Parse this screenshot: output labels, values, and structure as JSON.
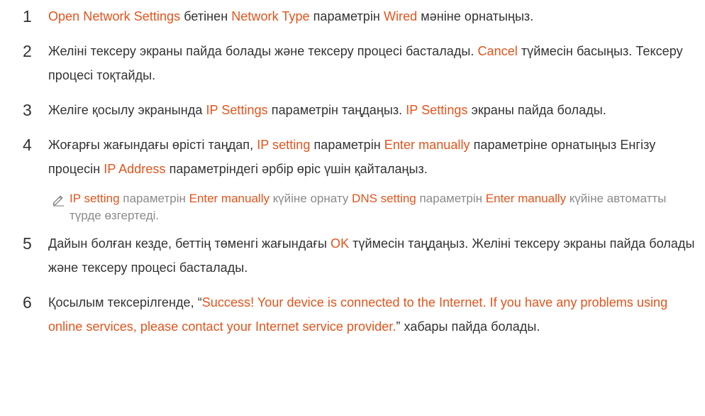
{
  "steps": [
    {
      "num": "1",
      "segments": [
        {
          "text": "Open Network Settings",
          "hl": true
        },
        {
          "text": " бетінен ",
          "hl": false
        },
        {
          "text": "Network Type",
          "hl": true
        },
        {
          "text": " параметрін ",
          "hl": false
        },
        {
          "text": "Wired",
          "hl": true
        },
        {
          "text": " мәніне орнатыңыз.",
          "hl": false
        }
      ]
    },
    {
      "num": "2",
      "segments": [
        {
          "text": "Желіні тексеру экраны пайда болады және тексеру процесі басталады. ",
          "hl": false
        },
        {
          "text": "Cancel",
          "hl": true
        },
        {
          "text": " түймесін басыңыз. Тексеру процесі тоқтайды.",
          "hl": false
        }
      ]
    },
    {
      "num": "3",
      "segments": [
        {
          "text": "Желіге қосылу экранында ",
          "hl": false
        },
        {
          "text": "IP Settings",
          "hl": true
        },
        {
          "text": " параметрін таңдаңыз. ",
          "hl": false
        },
        {
          "text": "IP Settings",
          "hl": true
        },
        {
          "text": " экраны пайда болады.",
          "hl": false
        }
      ]
    },
    {
      "num": "4",
      "segments": [
        {
          "text": "Жоғарғы жағындағы өрісті таңдап, ",
          "hl": false
        },
        {
          "text": "IP setting",
          "hl": true
        },
        {
          "text": " параметрін ",
          "hl": false
        },
        {
          "text": "Enter manually",
          "hl": true
        },
        {
          "text": " параметріне орнатыңыз Енгізу процесін ",
          "hl": false
        },
        {
          "text": "IP Address",
          "hl": true
        },
        {
          "text": " параметріндегі әрбір өріс үшін қайталаңыз.",
          "hl": false
        }
      ]
    },
    {
      "num": "5",
      "segments": [
        {
          "text": "Дайын болған кезде, беттің төменгі жағындағы ",
          "hl": false
        },
        {
          "text": "OK",
          "hl": true
        },
        {
          "text": " түймесін таңдаңыз. Желіні тексеру экраны пайда болады және тексеру процесі басталады.",
          "hl": false
        }
      ]
    },
    {
      "num": "6",
      "segments": [
        {
          "text": "Қосылым тексерілгенде, “",
          "hl": false
        },
        {
          "text": "Success! Your device is connected to the Internet. If you have any problems using online services, please contact your Internet service provider.",
          "hl": true
        },
        {
          "text": "” хабары пайда болады.",
          "hl": false
        }
      ]
    }
  ],
  "note": {
    "icon": "pencil-icon",
    "segments": [
      {
        "text": "IP setting",
        "hl": true
      },
      {
        "text": " параметрін ",
        "hl": false
      },
      {
        "text": "Enter manually",
        "hl": true
      },
      {
        "text": " күйіне орнату ",
        "hl": false
      },
      {
        "text": "DNS setting",
        "hl": true
      },
      {
        "text": " параметрін ",
        "hl": false
      },
      {
        "text": "Enter manually",
        "hl": true
      },
      {
        "text": " күйіне автоматты түрде өзгертеді.",
        "hl": false
      }
    ]
  },
  "colors": {
    "highlight": "#e2541c",
    "body_text": "#333333",
    "note_text": "#8a8a8a"
  }
}
